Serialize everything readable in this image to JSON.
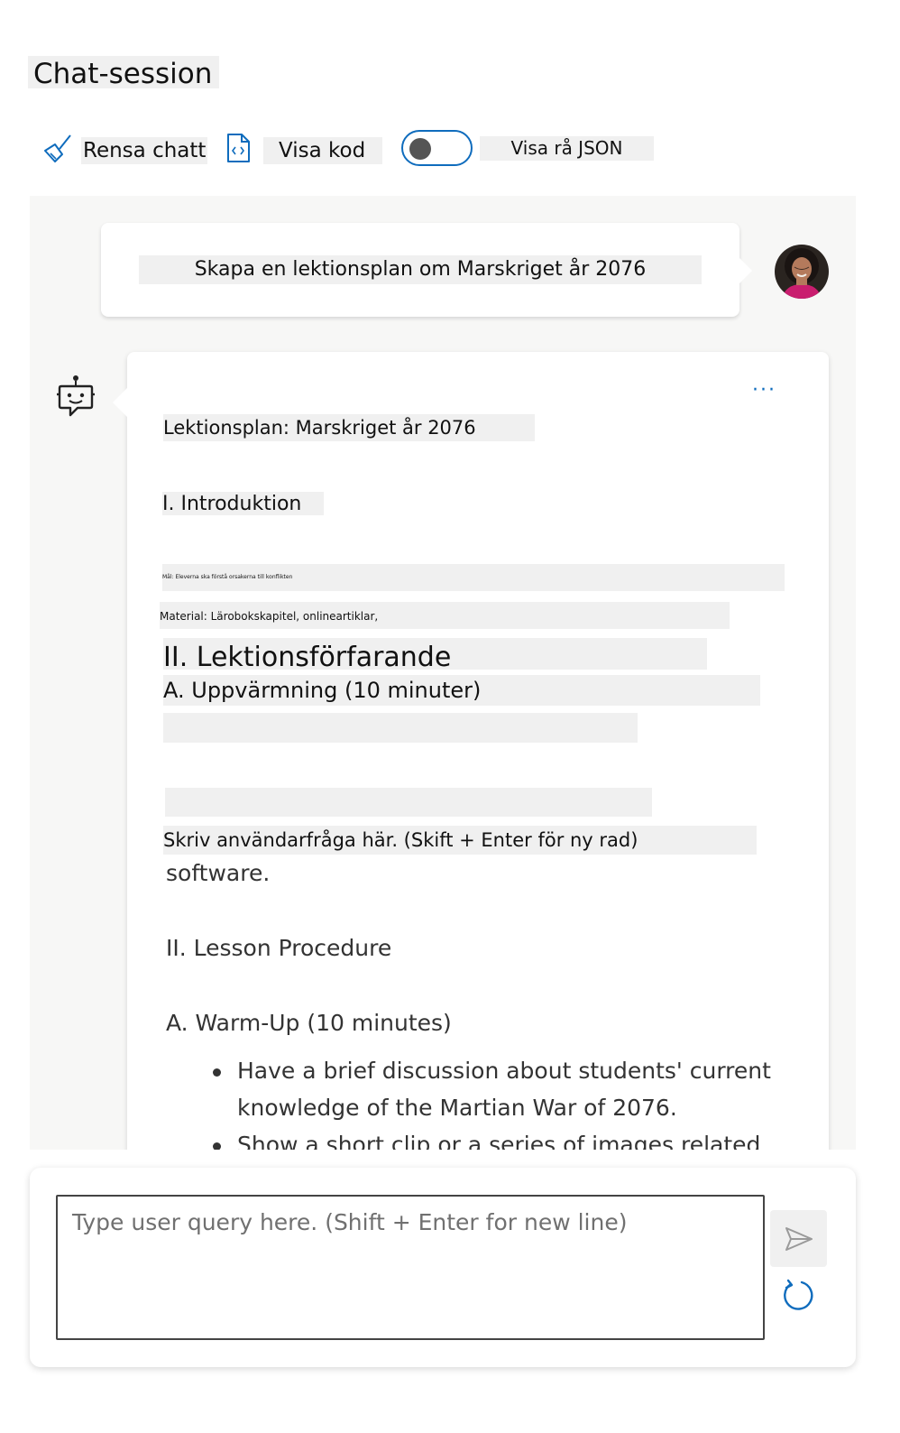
{
  "page": {
    "title": "Chat-session"
  },
  "toolbar": {
    "clear_label": "Rensa chatt",
    "code_label": "Visa kod",
    "json_toggle_label": "Visa rå JSON",
    "json_toggle_on": false
  },
  "chat": {
    "user_message": "Skapa en lektionsplan om Marskriget år 2076",
    "assistant": {
      "more_label": "···",
      "overlay": {
        "heading": "Lektionsplan: Marskriget år 2076",
        "section_intro": "I. Introduktion",
        "tiny_line": "Mål: Eleverna ska förstå orsakerna till konflikten",
        "materials": "Material: Lärobokskapitel, onlineartiklar,",
        "section_procedure": "II. Lektionsförfarande",
        "warmup": "A. Uppvärmning (10 minuter)",
        "placeholder_hint": "Skriv användarfråga här. (Skift + Enter för ny rad)"
      },
      "original": {
        "software_tail": "software.",
        "section_procedure": "II. Lesson Procedure",
        "warmup": "A. Warm-Up (10 minutes)",
        "bullets": [
          "Have a brief discussion about students' current knowledge of the Martian War of 2076.",
          "Show a short clip or a series of images related to"
        ]
      }
    }
  },
  "input": {
    "placeholder": "Type user query here. (Shift + Enter for new line)"
  },
  "colors": {
    "accent": "#0f6cbd",
    "chat_background": "#f7f7f6",
    "label_highlight": "#f0f0f0"
  },
  "icons": {
    "clear": "broom-icon",
    "code": "code-file-icon",
    "bot": "bot-icon",
    "send": "send-icon",
    "refresh": "refresh-icon"
  }
}
